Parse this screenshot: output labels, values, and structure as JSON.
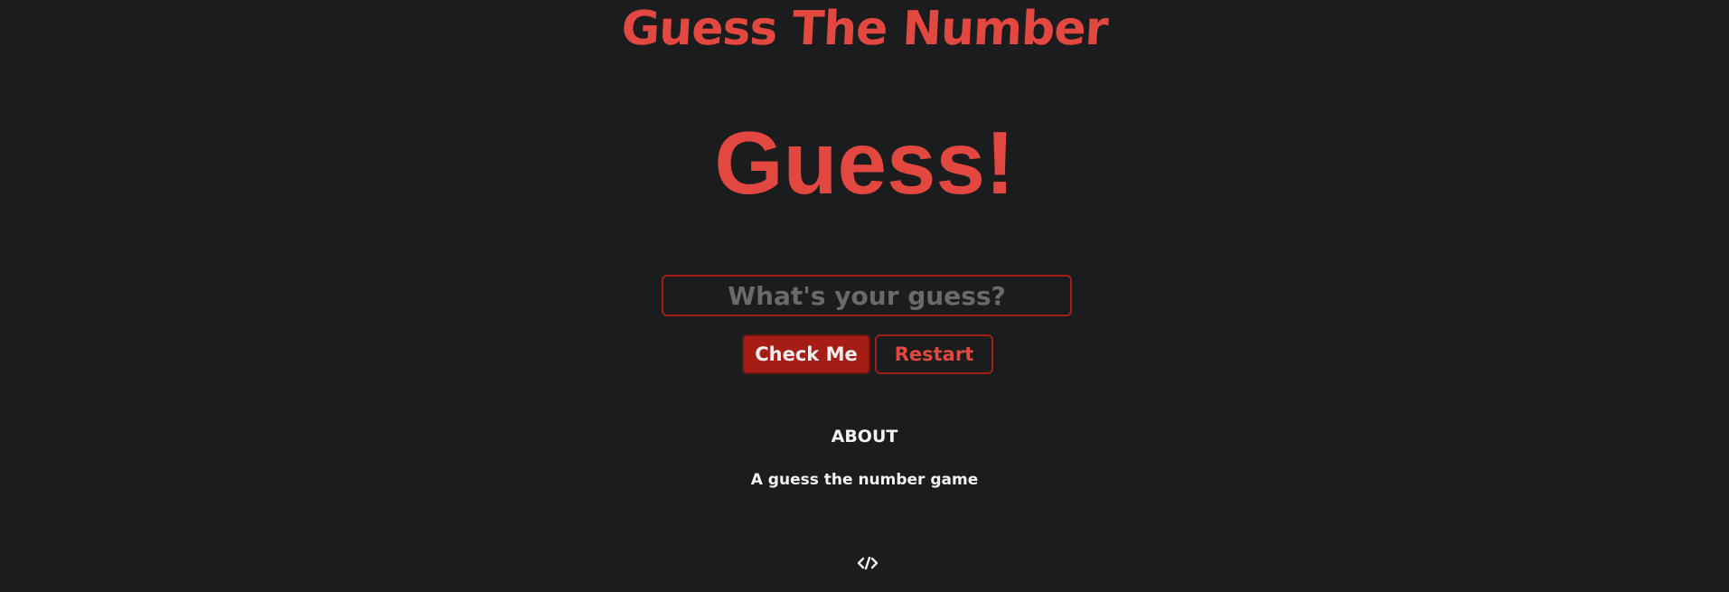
{
  "header": {
    "title": "Guess The Number"
  },
  "game": {
    "message": "Guess!",
    "input_placeholder": "What's your guess?",
    "input_value": "",
    "check_label": "Check Me",
    "restart_label": "Restart"
  },
  "about": {
    "heading": "ABOUT",
    "description": "A guess the number game"
  },
  "footer": {
    "code_icon": "code-icon"
  },
  "colors": {
    "background": "#1b1c1e",
    "accent": "#e2483f",
    "button_primary": "#a61d16",
    "text": "#f2f2f2"
  }
}
